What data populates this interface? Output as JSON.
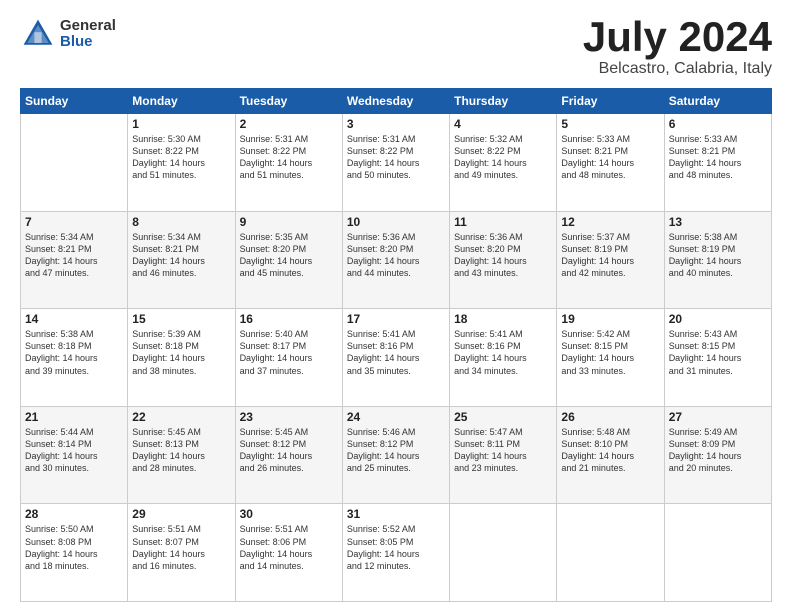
{
  "header": {
    "logo": {
      "general": "General",
      "blue": "Blue"
    },
    "title": "July 2024",
    "location": "Belcastro, Calabria, Italy"
  },
  "weekdays": [
    "Sunday",
    "Monday",
    "Tuesday",
    "Wednesday",
    "Thursday",
    "Friday",
    "Saturday"
  ],
  "weeks": [
    [
      {
        "day": "",
        "info": ""
      },
      {
        "day": "1",
        "info": "Sunrise: 5:30 AM\nSunset: 8:22 PM\nDaylight: 14 hours\nand 51 minutes."
      },
      {
        "day": "2",
        "info": "Sunrise: 5:31 AM\nSunset: 8:22 PM\nDaylight: 14 hours\nand 51 minutes."
      },
      {
        "day": "3",
        "info": "Sunrise: 5:31 AM\nSunset: 8:22 PM\nDaylight: 14 hours\nand 50 minutes."
      },
      {
        "day": "4",
        "info": "Sunrise: 5:32 AM\nSunset: 8:22 PM\nDaylight: 14 hours\nand 49 minutes."
      },
      {
        "day": "5",
        "info": "Sunrise: 5:33 AM\nSunset: 8:21 PM\nDaylight: 14 hours\nand 48 minutes."
      },
      {
        "day": "6",
        "info": "Sunrise: 5:33 AM\nSunset: 8:21 PM\nDaylight: 14 hours\nand 48 minutes."
      }
    ],
    [
      {
        "day": "7",
        "info": "Sunrise: 5:34 AM\nSunset: 8:21 PM\nDaylight: 14 hours\nand 47 minutes."
      },
      {
        "day": "8",
        "info": "Sunrise: 5:34 AM\nSunset: 8:21 PM\nDaylight: 14 hours\nand 46 minutes."
      },
      {
        "day": "9",
        "info": "Sunrise: 5:35 AM\nSunset: 8:20 PM\nDaylight: 14 hours\nand 45 minutes."
      },
      {
        "day": "10",
        "info": "Sunrise: 5:36 AM\nSunset: 8:20 PM\nDaylight: 14 hours\nand 44 minutes."
      },
      {
        "day": "11",
        "info": "Sunrise: 5:36 AM\nSunset: 8:20 PM\nDaylight: 14 hours\nand 43 minutes."
      },
      {
        "day": "12",
        "info": "Sunrise: 5:37 AM\nSunset: 8:19 PM\nDaylight: 14 hours\nand 42 minutes."
      },
      {
        "day": "13",
        "info": "Sunrise: 5:38 AM\nSunset: 8:19 PM\nDaylight: 14 hours\nand 40 minutes."
      }
    ],
    [
      {
        "day": "14",
        "info": "Sunrise: 5:38 AM\nSunset: 8:18 PM\nDaylight: 14 hours\nand 39 minutes."
      },
      {
        "day": "15",
        "info": "Sunrise: 5:39 AM\nSunset: 8:18 PM\nDaylight: 14 hours\nand 38 minutes."
      },
      {
        "day": "16",
        "info": "Sunrise: 5:40 AM\nSunset: 8:17 PM\nDaylight: 14 hours\nand 37 minutes."
      },
      {
        "day": "17",
        "info": "Sunrise: 5:41 AM\nSunset: 8:16 PM\nDaylight: 14 hours\nand 35 minutes."
      },
      {
        "day": "18",
        "info": "Sunrise: 5:41 AM\nSunset: 8:16 PM\nDaylight: 14 hours\nand 34 minutes."
      },
      {
        "day": "19",
        "info": "Sunrise: 5:42 AM\nSunset: 8:15 PM\nDaylight: 14 hours\nand 33 minutes."
      },
      {
        "day": "20",
        "info": "Sunrise: 5:43 AM\nSunset: 8:15 PM\nDaylight: 14 hours\nand 31 minutes."
      }
    ],
    [
      {
        "day": "21",
        "info": "Sunrise: 5:44 AM\nSunset: 8:14 PM\nDaylight: 14 hours\nand 30 minutes."
      },
      {
        "day": "22",
        "info": "Sunrise: 5:45 AM\nSunset: 8:13 PM\nDaylight: 14 hours\nand 28 minutes."
      },
      {
        "day": "23",
        "info": "Sunrise: 5:45 AM\nSunset: 8:12 PM\nDaylight: 14 hours\nand 26 minutes."
      },
      {
        "day": "24",
        "info": "Sunrise: 5:46 AM\nSunset: 8:12 PM\nDaylight: 14 hours\nand 25 minutes."
      },
      {
        "day": "25",
        "info": "Sunrise: 5:47 AM\nSunset: 8:11 PM\nDaylight: 14 hours\nand 23 minutes."
      },
      {
        "day": "26",
        "info": "Sunrise: 5:48 AM\nSunset: 8:10 PM\nDaylight: 14 hours\nand 21 minutes."
      },
      {
        "day": "27",
        "info": "Sunrise: 5:49 AM\nSunset: 8:09 PM\nDaylight: 14 hours\nand 20 minutes."
      }
    ],
    [
      {
        "day": "28",
        "info": "Sunrise: 5:50 AM\nSunset: 8:08 PM\nDaylight: 14 hours\nand 18 minutes."
      },
      {
        "day": "29",
        "info": "Sunrise: 5:51 AM\nSunset: 8:07 PM\nDaylight: 14 hours\nand 16 minutes."
      },
      {
        "day": "30",
        "info": "Sunrise: 5:51 AM\nSunset: 8:06 PM\nDaylight: 14 hours\nand 14 minutes."
      },
      {
        "day": "31",
        "info": "Sunrise: 5:52 AM\nSunset: 8:05 PM\nDaylight: 14 hours\nand 12 minutes."
      },
      {
        "day": "",
        "info": ""
      },
      {
        "day": "",
        "info": ""
      },
      {
        "day": "",
        "info": ""
      }
    ]
  ]
}
